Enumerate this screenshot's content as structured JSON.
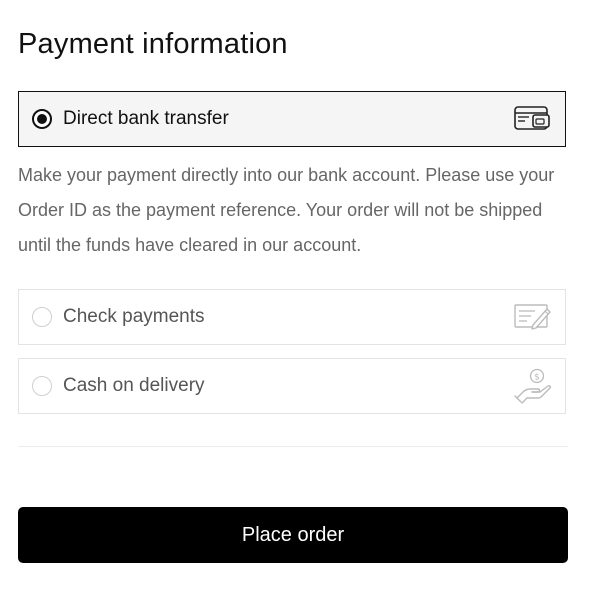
{
  "section": {
    "title": "Payment information"
  },
  "payment_methods": [
    {
      "label": "Direct bank transfer",
      "selected": true,
      "icon": "credit-card-icon"
    },
    {
      "label": "Check payments",
      "selected": false,
      "icon": "cheque-icon"
    },
    {
      "label": "Cash on delivery",
      "selected": false,
      "icon": "hand-money-icon"
    }
  ],
  "description": "Make your payment directly into our bank account. Please use your Order ID as the payment reference. Your order will not be shipped until the funds have cleared in our account.",
  "actions": {
    "place_order_label": "Place order"
  },
  "colors": {
    "primary": "#000000",
    "selected_bg": "#f5f5f5",
    "border": "#e3e3e3",
    "muted_text": "#666666"
  }
}
